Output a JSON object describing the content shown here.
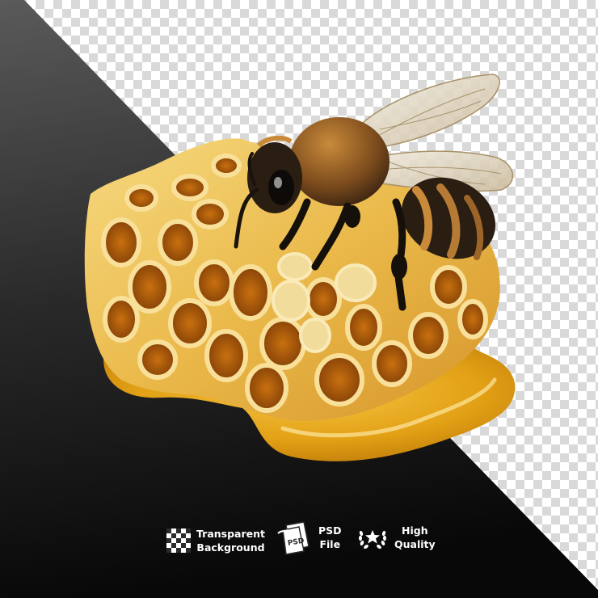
{
  "colors": {
    "checker_light": "#ffffff",
    "checker_dark": "#d9d9d9",
    "dark_panel_top": "#555555",
    "dark_panel_bottom": "#0c0c0c",
    "honey": "#e9a71c",
    "wax": "#f3d27a",
    "bee_body": "#2a1d12",
    "bee_fur": "#b57a33"
  },
  "image": {
    "subject": "honeycomb-with-bee"
  },
  "badges": {
    "transparent": {
      "line1": "Transparent",
      "line2": "Background",
      "icon": "checkerboard-icon"
    },
    "psd": {
      "line1": "PSD",
      "line2": "File",
      "icon": "psd-file-icon",
      "icon_text": "PSD"
    },
    "quality": {
      "line1": "High",
      "line2": "Quality",
      "icon": "laurel-star-icon"
    }
  }
}
